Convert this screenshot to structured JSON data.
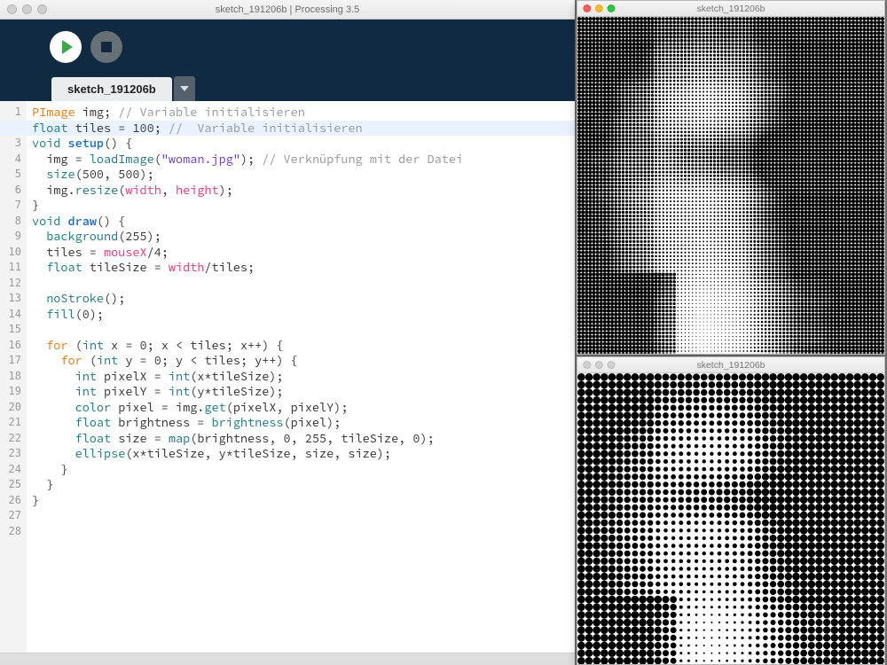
{
  "ide": {
    "window_title": "sketch_191206b | Processing 3.5",
    "tab_label": "sketch_191206b",
    "line_count": 28,
    "highlighted_line": 2,
    "code_lines": [
      [
        [
          "orange",
          "PImage"
        ],
        [
          "ident",
          " img; "
        ],
        [
          "comment",
          "// Variable initialisieren"
        ]
      ],
      [
        [
          "kw-teal",
          "float"
        ],
        [
          "ident",
          " tiles = "
        ],
        [
          "num",
          "100"
        ],
        [
          "ident",
          "; "
        ],
        [
          "comment",
          "//  Variable initialisieren"
        ]
      ],
      [
        [
          "kw-teal",
          "void"
        ],
        [
          "ident",
          " "
        ],
        [
          "kw-blue",
          "setup"
        ],
        [
          "ident",
          "() {"
        ]
      ],
      [
        [
          "ident",
          "  img = "
        ],
        [
          "kw-teal",
          "loadImage"
        ],
        [
          "ident",
          "("
        ],
        [
          "str",
          "\"woman.jpg\""
        ],
        [
          "ident",
          "); "
        ],
        [
          "comment",
          "// Verknüpfung mit der Datei"
        ]
      ],
      [
        [
          "ident",
          "  "
        ],
        [
          "kw-teal",
          "size"
        ],
        [
          "ident",
          "("
        ],
        [
          "num",
          "500"
        ],
        [
          "ident",
          ", "
        ],
        [
          "num",
          "500"
        ],
        [
          "ident",
          ");"
        ]
      ],
      [
        [
          "ident",
          "  img."
        ],
        [
          "kw-teal",
          "resize"
        ],
        [
          "ident",
          "("
        ],
        [
          "pink",
          "width"
        ],
        [
          "ident",
          ", "
        ],
        [
          "pink",
          "height"
        ],
        [
          "ident",
          ");"
        ]
      ],
      [
        [
          "ident",
          "}"
        ]
      ],
      [
        [
          "kw-teal",
          "void"
        ],
        [
          "ident",
          " "
        ],
        [
          "kw-blue",
          "draw"
        ],
        [
          "ident",
          "() {"
        ]
      ],
      [
        [
          "ident",
          "  "
        ],
        [
          "kw-teal",
          "background"
        ],
        [
          "ident",
          "("
        ],
        [
          "num",
          "255"
        ],
        [
          "ident",
          ");"
        ]
      ],
      [
        [
          "ident",
          "  tiles = "
        ],
        [
          "pink",
          "mouseX"
        ],
        [
          "ident",
          "/"
        ],
        [
          "num",
          "4"
        ],
        [
          "ident",
          ";"
        ]
      ],
      [
        [
          "ident",
          "  "
        ],
        [
          "kw-teal",
          "float"
        ],
        [
          "ident",
          " tileSize = "
        ],
        [
          "pink",
          "width"
        ],
        [
          "ident",
          "/tiles;"
        ]
      ],
      [],
      [
        [
          "ident",
          "  "
        ],
        [
          "kw-teal",
          "noStroke"
        ],
        [
          "ident",
          "();"
        ]
      ],
      [
        [
          "ident",
          "  "
        ],
        [
          "kw-teal",
          "fill"
        ],
        [
          "ident",
          "("
        ],
        [
          "num",
          "0"
        ],
        [
          "ident",
          ");"
        ]
      ],
      [],
      [
        [
          "ident",
          "  "
        ],
        [
          "orange",
          "for"
        ],
        [
          "ident",
          " ("
        ],
        [
          "kw-teal",
          "int"
        ],
        [
          "ident",
          " x = "
        ],
        [
          "num",
          "0"
        ],
        [
          "ident",
          "; x < tiles; x++) {"
        ]
      ],
      [
        [
          "ident",
          "    "
        ],
        [
          "orange",
          "for"
        ],
        [
          "ident",
          " ("
        ],
        [
          "kw-teal",
          "int"
        ],
        [
          "ident",
          " y = "
        ],
        [
          "num",
          "0"
        ],
        [
          "ident",
          "; y < tiles; y++) {"
        ]
      ],
      [
        [
          "ident",
          "      "
        ],
        [
          "kw-teal",
          "int"
        ],
        [
          "ident",
          " pixelX = "
        ],
        [
          "kw-teal",
          "int"
        ],
        [
          "ident",
          "(x*tileSize);"
        ]
      ],
      [
        [
          "ident",
          "      "
        ],
        [
          "kw-teal",
          "int"
        ],
        [
          "ident",
          " pixelY = "
        ],
        [
          "kw-teal",
          "int"
        ],
        [
          "ident",
          "(y*tileSize);"
        ]
      ],
      [
        [
          "ident",
          "      "
        ],
        [
          "kw-teal",
          "color"
        ],
        [
          "ident",
          " pixel = img."
        ],
        [
          "kw-teal",
          "get"
        ],
        [
          "ident",
          "(pixelX, pixelY);"
        ]
      ],
      [
        [
          "ident",
          "      "
        ],
        [
          "kw-teal",
          "float"
        ],
        [
          "ident",
          " brightness = "
        ],
        [
          "kw-teal",
          "brightness"
        ],
        [
          "ident",
          "(pixel);"
        ]
      ],
      [
        [
          "ident",
          "      "
        ],
        [
          "kw-teal",
          "float"
        ],
        [
          "ident",
          " size = "
        ],
        [
          "kw-teal",
          "map"
        ],
        [
          "ident",
          "(brightness, "
        ],
        [
          "num",
          "0"
        ],
        [
          "ident",
          ", "
        ],
        [
          "num",
          "255"
        ],
        [
          "ident",
          ", tileSize, "
        ],
        [
          "num",
          "0"
        ],
        [
          "ident",
          ");"
        ]
      ],
      [
        [
          "ident",
          "      "
        ],
        [
          "kw-teal",
          "ellipse"
        ],
        [
          "ident",
          "(x*tileSize, y*tileSize, size, size);"
        ]
      ],
      [
        [
          "ident",
          "    }"
        ]
      ],
      [
        [
          "ident",
          "  }"
        ]
      ],
      [
        [
          "ident",
          "}"
        ]
      ],
      [],
      []
    ]
  },
  "output1": {
    "title": "sketch_191206b",
    "tiles": 84
  },
  "output2": {
    "title": "sketch_191206b",
    "tiles": 40
  }
}
